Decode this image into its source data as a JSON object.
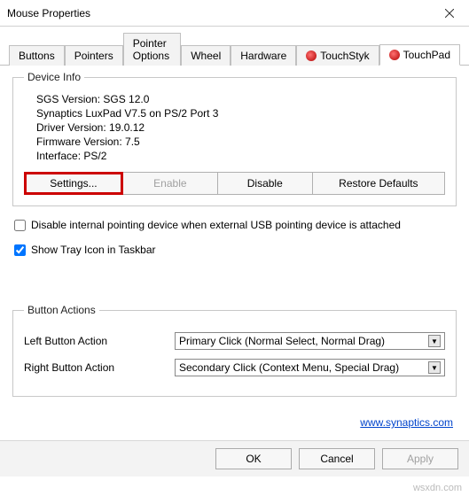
{
  "window": {
    "title": "Mouse Properties"
  },
  "tabs": [
    {
      "label": "Buttons"
    },
    {
      "label": "Pointers"
    },
    {
      "label": "Pointer Options"
    },
    {
      "label": "Wheel"
    },
    {
      "label": "Hardware"
    },
    {
      "label": "TouchStyk",
      "icon": true
    },
    {
      "label": "TouchPad",
      "icon": true,
      "active": true
    }
  ],
  "device_info": {
    "legend": "Device Info",
    "sgs_version": "SGS Version: SGS 12.0",
    "model": "Synaptics LuxPad V7.5 on PS/2 Port 3",
    "driver_version": "Driver Version: 19.0.12",
    "firmware_version": "Firmware Version: 7.5",
    "interface": "Interface: PS/2"
  },
  "buttons": {
    "settings": "Settings...",
    "enable": "Enable",
    "disable": "Disable",
    "restore": "Restore Defaults"
  },
  "checkboxes": {
    "disable_internal": "Disable internal pointing device when external USB pointing device is attached",
    "tray_icon": "Show Tray Icon in Taskbar"
  },
  "button_actions": {
    "legend": "Button Actions",
    "left_label": "Left Button Action",
    "left_value": "Primary Click (Normal Select, Normal Drag)",
    "right_label": "Right Button Action",
    "right_value": "Secondary Click (Context Menu, Special Drag)"
  },
  "link": {
    "text": "www.synaptics.com"
  },
  "footer": {
    "ok": "OK",
    "cancel": "Cancel",
    "apply": "Apply"
  },
  "watermark": "wsxdn.com"
}
